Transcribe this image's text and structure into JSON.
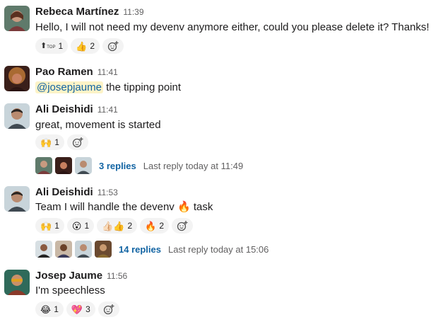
{
  "messages": [
    {
      "author": "Rebeca Martínez",
      "time": "11:39",
      "text": "Hello, I will not need my devenv anymore either, could you please delete it? Thanks!",
      "reactions": [
        {
          "icon": "top-arrow-icon",
          "emoji": "⬆",
          "count": "1"
        },
        {
          "icon": "thumbs-up-icon",
          "emoji": "👍",
          "count": "2"
        }
      ]
    },
    {
      "author": "Pao Ramen",
      "time": "11:41",
      "mention": "@josepjaume",
      "text": "the tipping point"
    },
    {
      "author": "Ali Deishidi",
      "time": "11:41",
      "text": "great, movement is started",
      "reactions": [
        {
          "icon": "raised-hands-icon",
          "emoji": "🙌",
          "count": "1"
        }
      ],
      "thread": {
        "replies": "3 replies",
        "last_reply": "Last reply today at 11:49"
      }
    },
    {
      "author": "Ali Deishidi",
      "time": "11:53",
      "text_before": "Team I will handle the devenv",
      "text_emoji": "🔥",
      "text_after": "task",
      "reactions": [
        {
          "icon": "raised-hands-icon",
          "emoji": "🙌",
          "count": "1"
        },
        {
          "icon": "hushed-face-icon",
          "emoji": "😮",
          "count": "1"
        },
        {
          "icon": "thumbs-up-multi-icon",
          "emoji": "👍🏻👍",
          "count": "2"
        },
        {
          "icon": "fire-icon",
          "emoji": "🔥",
          "count": "2"
        }
      ],
      "thread": {
        "replies": "14 replies",
        "last_reply": "Last reply today at 15:06"
      }
    },
    {
      "author": "Josep Jaume",
      "time": "11:56",
      "text": "I'm speechless",
      "reactions": [
        {
          "icon": "joy-icon",
          "emoji": "😂",
          "count": "1"
        },
        {
          "icon": "sparkling-heart-icon",
          "emoji": "💖",
          "count": "3"
        }
      ]
    }
  ]
}
